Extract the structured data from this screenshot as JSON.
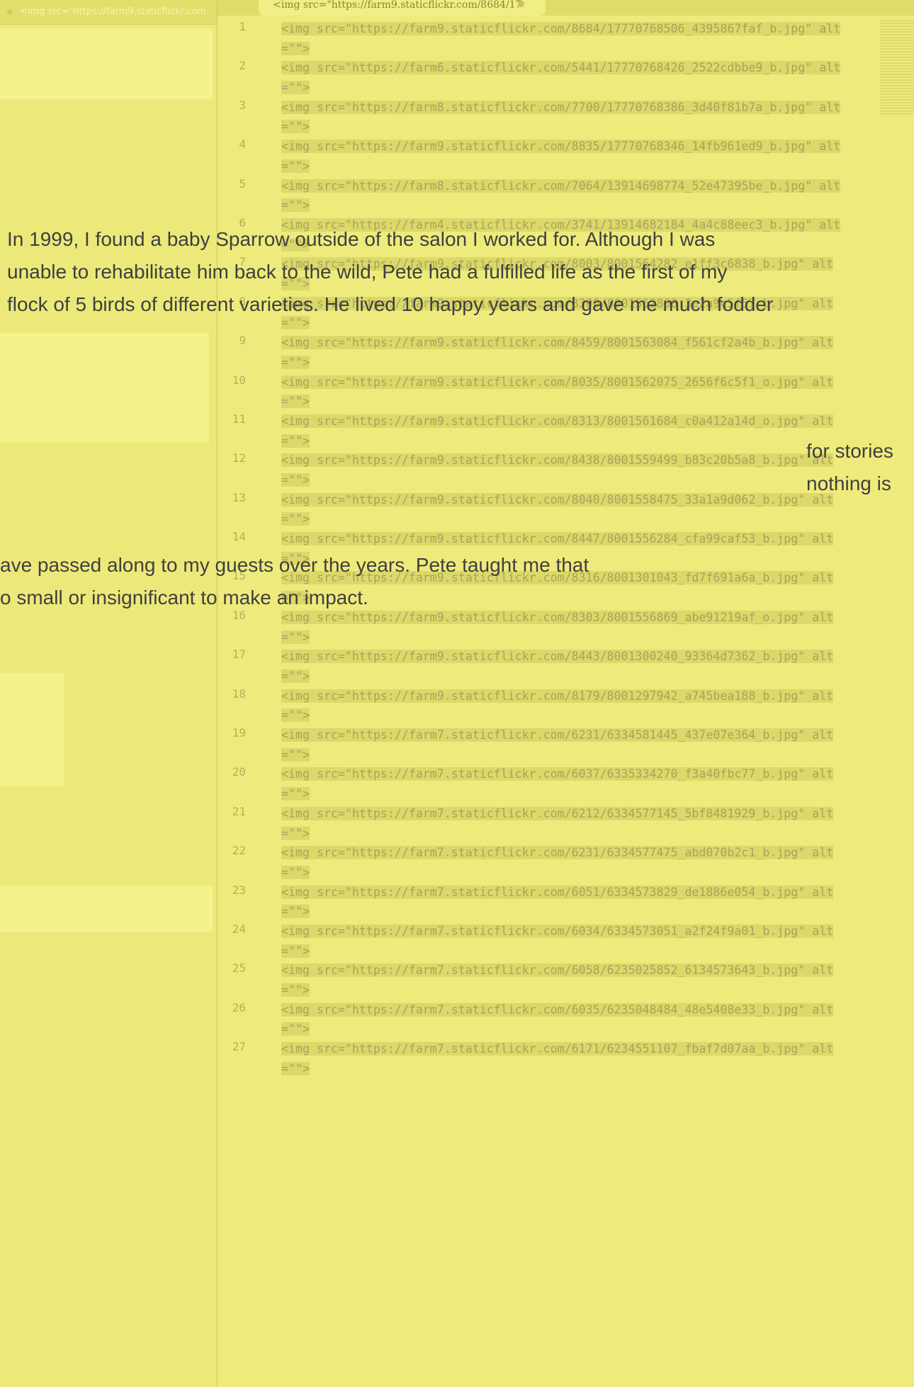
{
  "sidebar": {
    "tab_label": "<img src=\"https://farm9.staticflickr.com"
  },
  "editor": {
    "active_tab": "<img src=\"https://farm9.staticflickr.com/8684/17",
    "lines": [
      {
        "num": "1",
        "text": "<img src=\"https://farm9.staticflickr.com/8684/17770768506_4395867faf_b.jpg\" alt=\"\">"
      },
      {
        "num": "2",
        "text": "<img src=\"https://farm6.staticflickr.com/5441/17770768426_2522cdbbe9_b.jpg\" alt=\"\">"
      },
      {
        "num": "3",
        "text": "<img src=\"https://farm8.staticflickr.com/7700/17770768386_3d40f81b7a_b.jpg\" alt=\"\">"
      },
      {
        "num": "4",
        "text": "<img src=\"https://farm9.staticflickr.com/8835/17770768346_14fb961ed9_b.jpg\" alt=\"\">"
      },
      {
        "num": "5",
        "text": "<img src=\"https://farm8.staticflickr.com/7064/13914698774_52e47395be_b.jpg\" alt=\"\">"
      },
      {
        "num": "6",
        "text": "<img src=\"https://farm4.staticflickr.com/3741/13914682184_4a4c88eec3_b.jpg\" alt=\"\">"
      },
      {
        "num": "7",
        "text": "<img src=\"https://farm9.staticflickr.com/8003/8001564282_e1ff3c6838_b.jpg\" alt=\"\">"
      },
      {
        "num": "8",
        "text": "<img src=\"https://farm9.staticflickr.com/8306/8001562868_3e2a9c5f57_b.jpg\" alt=\"\">"
      },
      {
        "num": "9",
        "text": "<img src=\"https://farm9.staticflickr.com/8459/8001563084_f561cf2a4b_b.jpg\" alt=\"\">"
      },
      {
        "num": "10",
        "text": "<img src=\"https://farm9.staticflickr.com/8035/8001562075_2656f6c5f1_o.jpg\" alt=\"\">"
      },
      {
        "num": "11",
        "text": "<img src=\"https://farm9.staticflickr.com/8313/8001561684_c0a412a14d_o.jpg\" alt=\"\">"
      },
      {
        "num": "12",
        "text": "<img src=\"https://farm9.staticflickr.com/8438/8001559499_b83c20b5a8_b.jpg\" alt=\"\">"
      },
      {
        "num": "13",
        "text": "<img src=\"https://farm9.staticflickr.com/8040/8001558475_33a1a9d062_b.jpg\" alt=\"\">"
      },
      {
        "num": "14",
        "text": "<img src=\"https://farm9.staticflickr.com/8447/8001556284_cfa99caf53_b.jpg\" alt=\"\">"
      },
      {
        "num": "15",
        "text": "<img src=\"https://farm9.staticflickr.com/8316/8001301043_fd7f691a6a_b.jpg\" alt=\"\">"
      },
      {
        "num": "16",
        "text": "<img src=\"https://farm9.staticflickr.com/8303/8001556869_abe91219af_o.jpg\" alt=\"\">"
      },
      {
        "num": "17",
        "text": "<img src=\"https://farm9.staticflickr.com/8443/8001300240_93364d7362_b.jpg\" alt=\"\">"
      },
      {
        "num": "18",
        "text": "<img src=\"https://farm9.staticflickr.com/8179/8001297942_a745bea188_b.jpg\" alt=\"\">"
      },
      {
        "num": "19",
        "text": "<img src=\"https://farm7.staticflickr.com/6231/6334581445_437e07e364_b.jpg\" alt=\"\">"
      },
      {
        "num": "20",
        "text": "<img src=\"https://farm7.staticflickr.com/6037/6335334270_f3a40fbc77_b.jpg\" alt=\"\">"
      },
      {
        "num": "21",
        "text": "<img src=\"https://farm7.staticflickr.com/6212/6334577145_5bf8481929_b.jpg\" alt=\"\">"
      },
      {
        "num": "22",
        "text": "<img src=\"https://farm7.staticflickr.com/6231/6334577475_abd070b2c1_b.jpg\" alt=\"\">"
      },
      {
        "num": "23",
        "text": "<img src=\"https://farm7.staticflickr.com/6051/6334573829_de1886e054_b.jpg\" alt=\"\">"
      },
      {
        "num": "24",
        "text": "<img src=\"https://farm7.staticflickr.com/6034/6334573051_a2f24f9a01_b.jpg\" alt=\"\">"
      },
      {
        "num": "25",
        "text": "<img src=\"https://farm7.staticflickr.com/6058/6235025852_6134573643_b.jpg\" alt=\"\">"
      },
      {
        "num": "26",
        "text": "<img src=\"https://farm7.staticflickr.com/6035/6235048484_48e5408e33_b.jpg\" alt=\"\">"
      },
      {
        "num": "27",
        "text": "<img src=\"https://farm7.staticflickr.com/6171/6234551107_fbaf7d07aa_b.jpg\" alt=\"\">"
      }
    ]
  },
  "overlay": {
    "para_a": [
      "In 1999, I found a baby Sparrow outside of the salon I worked for. Although I was",
      "unable to rehabilitate him back to the wild, Pete had a fulfilled life as the first of my",
      "flock of 5 birds of different varieties. He lived 10 happy years and gave me much fodder"
    ],
    "para_b": [
      "for stories",
      "nothing is"
    ],
    "para_c": [
      "ave passed along to my guests over the years. Pete taught me that",
      "o small or insignificant to make an impact."
    ]
  }
}
